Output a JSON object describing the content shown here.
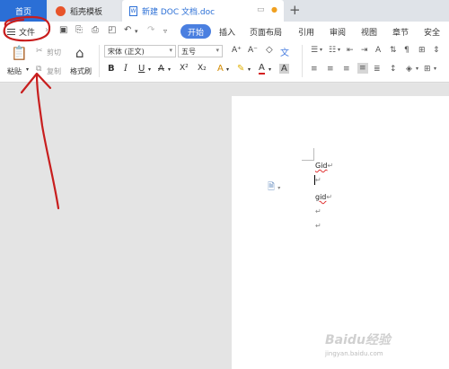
{
  "tabs": {
    "home": "首页",
    "templates": "稻壳模板",
    "document": "新建 DOC 文档.doc",
    "add_icon": "plus-icon"
  },
  "menubar": {
    "file": "文件",
    "items": [
      "开始",
      "插入",
      "页面布局",
      "引用",
      "审阅",
      "视图",
      "章节",
      "安全"
    ]
  },
  "ribbon": {
    "paste": "粘贴",
    "cut": "剪切",
    "copy": "复制",
    "format_painter": "格式刷",
    "font_name": "宋体 (正文)",
    "font_size": "五号",
    "bold": "B",
    "italic": "I",
    "underline": "U",
    "strikethrough": "A",
    "superscript": "X²",
    "subscript": "X₂",
    "grow": "A⁺",
    "shrink": "A⁻",
    "clear": "◇",
    "highlight": "✎",
    "font_color": "A",
    "char_shade": "A"
  },
  "document": {
    "lines": [
      "Gid",
      "",
      "gid",
      ""
    ],
    "paragraph_mark": "↵"
  },
  "watermark": {
    "brand": "Baidu经验",
    "url": "jingyan.baidu.com"
  },
  "colors": {
    "accent": "#2b6fd6",
    "annotation": "#c81e1e"
  }
}
